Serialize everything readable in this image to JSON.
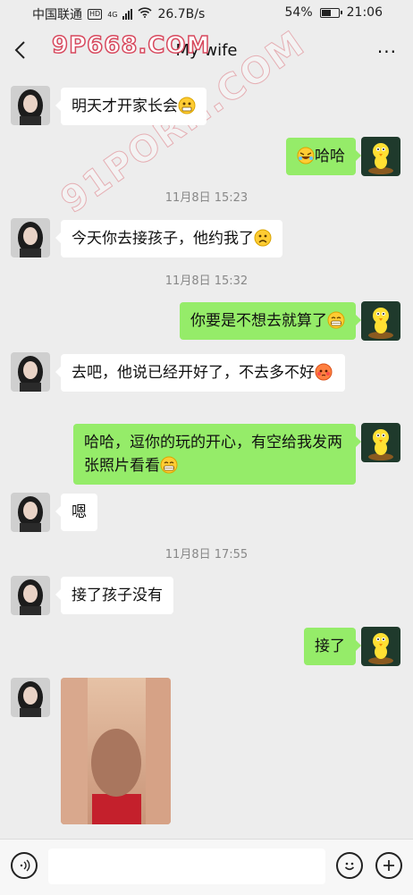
{
  "status_bar": {
    "carrier": "中国联通",
    "hd": "HD",
    "network": "4G",
    "speed": "26.7B/s",
    "battery": "54%",
    "battery_level": 0.54,
    "time": "21:06"
  },
  "header": {
    "title": "My wife",
    "more": "···"
  },
  "watermarks": [
    "9P668.COM",
    "91PORN.COM"
  ],
  "messages": [
    {
      "side": "left",
      "text": "明天才开家长会",
      "emoji": "grimace-emoji"
    },
    {
      "side": "right",
      "text": "哈哈",
      "emoji": "laugh-emoji",
      "emoji_first": true
    },
    {
      "type": "time",
      "text": "11月8日 15:23"
    },
    {
      "side": "left",
      "text": "今天你去接孩子，他约我了",
      "emoji": "frown-emoji"
    },
    {
      "type": "time",
      "text": "11月8日 15:32"
    },
    {
      "side": "right",
      "text": "你要是不想去就算了",
      "emoji": "grin-emoji"
    },
    {
      "side": "left",
      "text": "去吧，他说已经开好了，不去多不好",
      "emoji": "blush-emoji"
    },
    {
      "side": "right",
      "text": "哈哈，逗你的玩的开心，有空给我发两张照片看看",
      "emoji": "grin-emoji"
    },
    {
      "side": "left",
      "text": "嗯"
    },
    {
      "type": "time",
      "text": "11月8日 17:55"
    },
    {
      "side": "left",
      "text": "接了孩子没有"
    },
    {
      "side": "right",
      "text": "接了"
    },
    {
      "side": "left",
      "type": "image"
    }
  ],
  "colors": {
    "background": "#ededed",
    "sent_bubble": "#95ec69",
    "received_bubble": "#ffffff",
    "timestamp": "#888888",
    "watermark": "#d7495e"
  },
  "icons": {
    "back": "chevron-left-icon",
    "more": "more-dots-icon",
    "voice": "voice-icon",
    "emoji": "smiley-icon",
    "plus": "plus-icon"
  }
}
